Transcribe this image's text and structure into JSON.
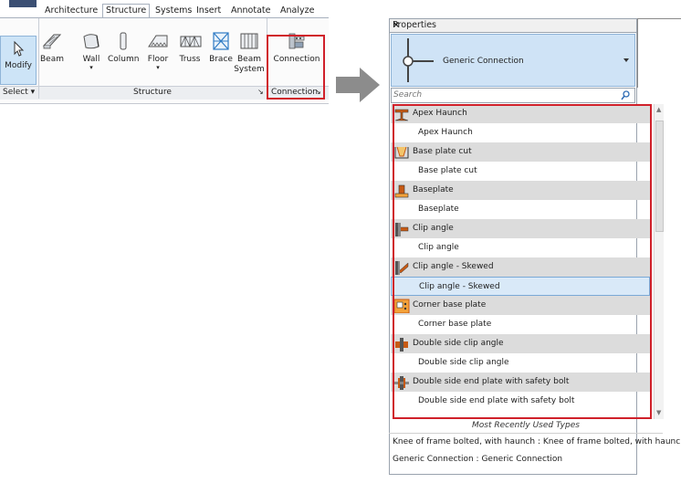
{
  "ribbon": {
    "tabs": [
      "Architecture",
      "Structure",
      "Systems",
      "Insert",
      "Annotate",
      "Analyze"
    ],
    "active_tab": "Structure",
    "modify_label": "Modify",
    "buttons": [
      {
        "label": "Beam",
        "icon": "beam-icon",
        "dropdown": false
      },
      {
        "label": "Wall",
        "icon": "wall-icon",
        "dropdown": true
      },
      {
        "label": "Column",
        "icon": "column-icon",
        "dropdown": false
      },
      {
        "label": "Floor",
        "icon": "floor-icon",
        "dropdown": true
      },
      {
        "label": "Truss",
        "icon": "truss-icon",
        "dropdown": false
      },
      {
        "label": "Brace",
        "icon": "brace-icon",
        "dropdown": false
      },
      {
        "label": "Beam System",
        "icon": "beam-system-icon",
        "dropdown": false
      }
    ],
    "connection_label": "Connection",
    "panels": {
      "select": "Select",
      "structure": "Structure",
      "connection": "Connection"
    }
  },
  "properties": {
    "title": "Properties",
    "close": "×",
    "type_name": "Generic Connection",
    "search_placeholder": "Search",
    "list": [
      {
        "kind": "group",
        "label": "Apex Haunch",
        "icon": "apex-haunch-icon"
      },
      {
        "kind": "item",
        "label": "Apex Haunch"
      },
      {
        "kind": "group",
        "label": "Base plate cut",
        "icon": "base-plate-cut-icon"
      },
      {
        "kind": "item",
        "label": "Base plate cut"
      },
      {
        "kind": "group",
        "label": "Baseplate",
        "icon": "baseplate-icon"
      },
      {
        "kind": "item",
        "label": "Baseplate"
      },
      {
        "kind": "group",
        "label": "Clip angle",
        "icon": "clip-angle-icon"
      },
      {
        "kind": "item",
        "label": "Clip angle"
      },
      {
        "kind": "group",
        "label": "Clip angle - Skewed",
        "icon": "clip-angle-skewed-icon"
      },
      {
        "kind": "item",
        "label": "Clip angle - Skewed",
        "selected": true
      },
      {
        "kind": "group",
        "label": "Corner base plate",
        "icon": "corner-base-plate-icon"
      },
      {
        "kind": "item",
        "label": "Corner base plate"
      },
      {
        "kind": "group",
        "label": "Double side clip angle",
        "icon": "double-side-clip-angle-icon"
      },
      {
        "kind": "item",
        "label": "Double side clip angle"
      },
      {
        "kind": "group",
        "label": "Double side end plate with safety bolt",
        "icon": "double-side-end-plate-icon"
      },
      {
        "kind": "item",
        "label": "Double side end plate with safety bolt"
      }
    ],
    "mru_title": "Most Recently Used Types",
    "mru_items": [
      "Knee of frame bolted, with haunch : Knee of frame bolted, with haunch",
      "Generic Connection : Generic Connection"
    ]
  },
  "colors": {
    "highlight": "#d0202a",
    "selection": "#cfe3f6",
    "arrow": "#8c8c8c"
  }
}
